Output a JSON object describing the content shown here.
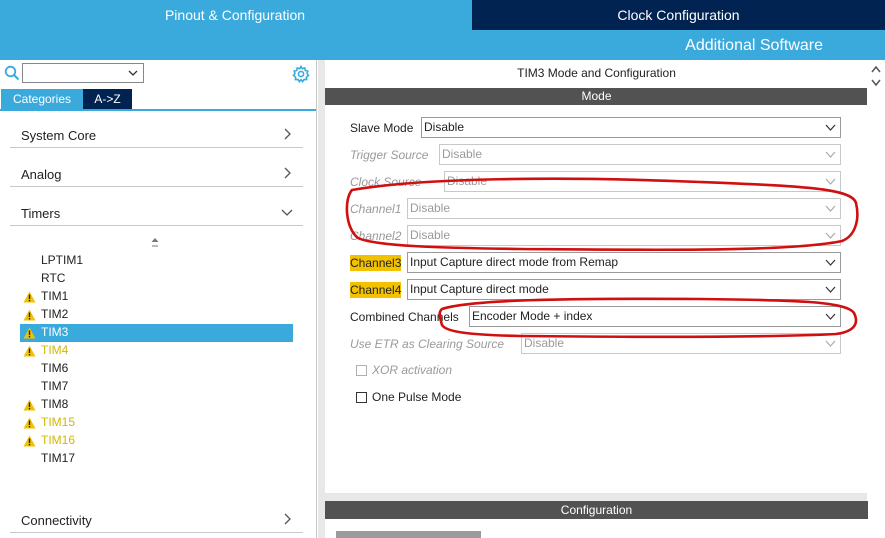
{
  "header": {
    "tab_pinout": "Pinout & Configuration",
    "tab_clock": "Clock Configuration",
    "additional_software": "Additional Software"
  },
  "sidebar": {
    "search_value": "",
    "tabs": {
      "categories": "Categories",
      "atoz": "A->Z"
    },
    "categories": [
      "System Core",
      "Analog",
      "Timers",
      "Connectivity"
    ],
    "timers": [
      {
        "name": "LPTIM1",
        "status": "none"
      },
      {
        "name": "RTC",
        "status": "none"
      },
      {
        "name": "TIM1",
        "status": "warning"
      },
      {
        "name": "TIM2",
        "status": "warning"
      },
      {
        "name": "TIM3",
        "status": "warning",
        "selected": true
      },
      {
        "name": "TIM4",
        "status": "warning-yellow"
      },
      {
        "name": "TIM6",
        "status": "none"
      },
      {
        "name": "TIM7",
        "status": "none"
      },
      {
        "name": "TIM8",
        "status": "warning"
      },
      {
        "name": "TIM15",
        "status": "warning-yellow"
      },
      {
        "name": "TIM16",
        "status": "warning-yellow"
      },
      {
        "name": "TIM17",
        "status": "none"
      }
    ]
  },
  "main": {
    "title": "TIM3 Mode and Configuration",
    "mode_header": "Mode",
    "fields": {
      "slave_mode": {
        "label": "Slave Mode",
        "value": "Disable"
      },
      "trigger_source": {
        "label": "Trigger Source",
        "value": "Disable"
      },
      "clock_source": {
        "label": "Clock Source",
        "value": "Disable"
      },
      "channel1": {
        "label": "Channel1",
        "value": "Disable"
      },
      "channel2": {
        "label": "Channel2",
        "value": "Disable"
      },
      "channel3": {
        "label": "Channel3",
        "value": "Input Capture direct mode from Remap"
      },
      "channel4": {
        "label": "Channel4",
        "value": "Input Capture direct mode"
      },
      "combined_channels": {
        "label": "Combined Channels",
        "value": "Encoder Mode + index"
      },
      "use_etr": {
        "label": "Use ETR as Clearing Source",
        "value": "Disable"
      }
    },
    "checks": {
      "xor": {
        "label": "XOR activation",
        "checked": false
      },
      "one_pulse": {
        "label": "One Pulse Mode",
        "checked": false
      }
    },
    "config_header": "Configuration"
  },
  "colors": {
    "accent": "#3aa9dc",
    "navy": "#002352",
    "section_header": "#525252",
    "highlight": "#f2c200",
    "warning": "#f2c200",
    "annotation": "#d01010"
  }
}
